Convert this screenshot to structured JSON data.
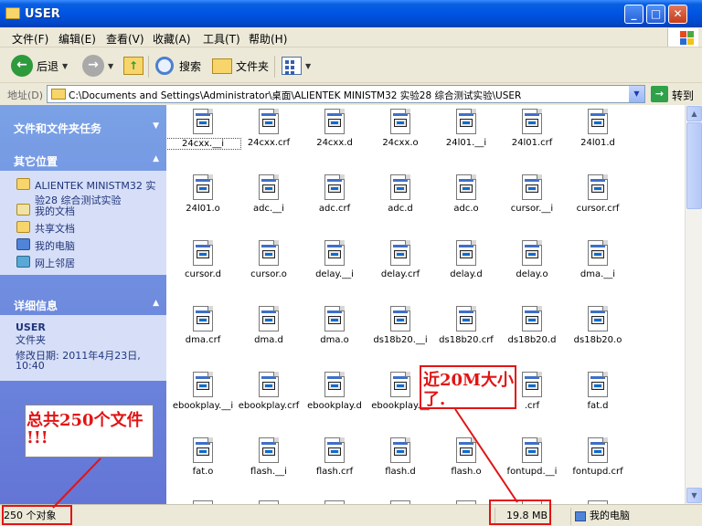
{
  "window": {
    "title": "USER"
  },
  "menu": [
    "文件(F)",
    "编辑(E)",
    "查看(V)",
    "收藏(A)",
    "工具(T)",
    "帮助(H)"
  ],
  "toolbar": {
    "back": "后退",
    "search": "搜索",
    "folders": "文件夹"
  },
  "address": {
    "label": "地址(D)",
    "path": "C:\\Documents and Settings\\Administrator\\桌面\\ALIENTEK MINISTM32 实验28 综合测试实验\\USER",
    "go": "转到"
  },
  "left_panel": {
    "tasks_title": "文件和文件夹任务",
    "other_title": "其它位置",
    "other_places": [
      {
        "label": "ALIENTEK MINISTM32 实",
        "label2": "验28 综合测试实验",
        "icon": "folder-icon"
      },
      {
        "label": "我的文档",
        "icon": "my-documents-icon"
      },
      {
        "label": "共享文档",
        "icon": "shared-documents-icon"
      },
      {
        "label": "我的电脑",
        "icon": "my-computer-icon"
      },
      {
        "label": "网上邻居",
        "icon": "network-places-icon"
      }
    ],
    "details_title": "详细信息",
    "details": {
      "name": "USER",
      "type": "文件夹",
      "modified_label": "修改日期: 2011年4月23日,",
      "modified_time": "10:40"
    }
  },
  "files": [
    [
      "24cxx.__i",
      "24cxx.crf",
      "24cxx.d",
      "24cxx.o",
      "24l01.__i",
      "24l01.crf",
      "24l01.d"
    ],
    [
      "24l01.o",
      "adc.__i",
      "adc.crf",
      "adc.d",
      "adc.o",
      "cursor.__i",
      "cursor.crf"
    ],
    [
      "cursor.d",
      "cursor.o",
      "delay.__i",
      "delay.crf",
      "delay.d",
      "delay.o",
      "dma.__i"
    ],
    [
      "dma.crf",
      "dma.d",
      "dma.o",
      "ds18b20.__i",
      "ds18b20.crf",
      "ds18b20.d",
      "ds18b20.o"
    ],
    [
      "ebookplay.__i",
      "ebookplay.crf",
      "ebookplay.d",
      "ebookplay.__",
      "",
      ".crf",
      "fat.d"
    ],
    [
      "fat.o",
      "flash.__i",
      "flash.crf",
      "flash.d",
      "flash.o",
      "fontupd.__i",
      "fontupd.crf"
    ]
  ],
  "status": {
    "count": "250 个对象",
    "size": "19.8 MB",
    "location": "我的电脑"
  },
  "annotations": {
    "total": "总共250个文件",
    "total2": "!!!",
    "size1": "近20M大小",
    "size2": "了."
  },
  "colors": {
    "annotation": "#e21414",
    "titlebar": "#0054e3",
    "panel": "#7aa1e6"
  }
}
